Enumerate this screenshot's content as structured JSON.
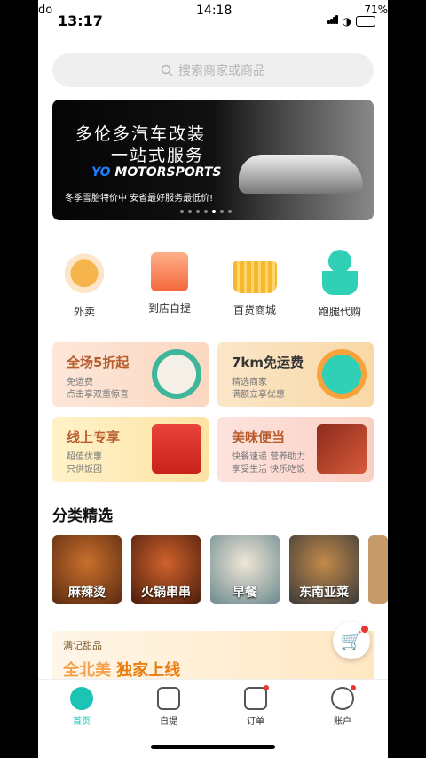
{
  "status": {
    "carrier": "do",
    "time_left": "13:17",
    "time_center": "14:18",
    "battery": "71%"
  },
  "search": {
    "placeholder": "搜索商家或商品"
  },
  "banner": {
    "line1": "多伦多汽车改装",
    "line2": "一站式服务",
    "brand_prefix": "YO",
    "brand_suffix": "MOTORSPORTS",
    "subtitle": "冬季雪胎特价中 安省最好服务最低价!"
  },
  "quick_actions": [
    {
      "label": "外卖",
      "icon": "roast-chicken-icon"
    },
    {
      "label": "到店自提",
      "icon": "shopping-bag-icon"
    },
    {
      "label": "百货商城",
      "icon": "basket-icon"
    },
    {
      "label": "跑腿代购",
      "icon": "courier-icon"
    }
  ],
  "promos": [
    {
      "title": "全场5折起",
      "sub1": "免运费",
      "sub2": "点击享双重惊喜",
      "color": "#b85c2d"
    },
    {
      "title": "7km免运费",
      "sub1": "精选商家",
      "sub2": "满额立享优惠",
      "color": "#333333"
    },
    {
      "title": "线上专享",
      "sub1": "超值优惠",
      "sub2": "只供饭团",
      "color": "#b85c2d"
    },
    {
      "title": "美味便当",
      "sub1": "快餐速递 营养助力",
      "sub2": "享受生活 快乐吃饭",
      "color": "#b85c2d"
    }
  ],
  "section": {
    "title": "分类精选"
  },
  "categories": [
    {
      "label": "麻辣烫"
    },
    {
      "label": "火锅串串"
    },
    {
      "label": "早餐"
    },
    {
      "label": "东南亚菜"
    }
  ],
  "ad": {
    "brand": "满记甜品",
    "slogan_prefix": "全北美",
    "slogan_highlight": "独家上线"
  },
  "tabs": [
    {
      "label": "首页",
      "active": true
    },
    {
      "label": "自提"
    },
    {
      "label": "订单"
    },
    {
      "label": "账户"
    }
  ],
  "colors": {
    "accent": "#1bc4b5",
    "badge": "#e53935"
  }
}
